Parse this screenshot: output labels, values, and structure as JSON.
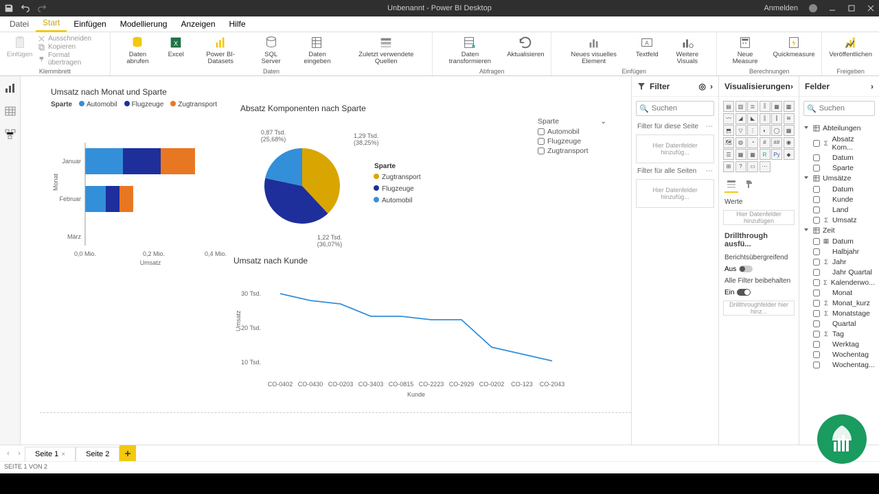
{
  "titlebar": {
    "title": "Unbenannt - Power BI Desktop",
    "signin": "Anmelden"
  },
  "menu": {
    "file": "Datei",
    "tabs": [
      "Start",
      "Einfügen",
      "Modellierung",
      "Anzeigen",
      "Hilfe"
    ],
    "active": 0
  },
  "ribbon": {
    "clip": {
      "paste": "Einfügen",
      "cut": "Ausschneiden",
      "copy": "Kopieren",
      "format": "Format übertragen",
      "label": "Klemmbrett"
    },
    "data": {
      "get": "Daten\nabrufen",
      "excel": "Excel",
      "pbids": "Power\nBI-Datasets",
      "sql": "SQL\nServer",
      "enter": "Daten\neingeben",
      "recent": "Zuletzt verwendete\nQuellen",
      "label": "Daten"
    },
    "query": {
      "transform": "Daten\ntransformieren",
      "refresh": "Aktualisieren",
      "label": "Abfragen"
    },
    "insert": {
      "visual": "Neues visuelles\nElement",
      "textbox": "Textfeld",
      "more": "Weitere\nVisuals",
      "label": "Einfügen"
    },
    "calc": {
      "measure": "Neue\nMeasure",
      "quick": "Quickmeasure",
      "label": "Berechnungen"
    },
    "share": {
      "publish": "Veröffentlichen",
      "label": "Freigeben"
    }
  },
  "filters": {
    "title": "Filter",
    "search": "Suchen",
    "page": "Filter für diese Seite",
    "page_hint": "Hier Datenfelder hinzufüg...",
    "all": "Filter für alle Seiten",
    "all_hint": "Hier Datenfelder hinzufüg..."
  },
  "vis": {
    "title": "Visualisierungen",
    "values": "Werte",
    "values_hint": "Hier Datenfelder hinzufügen",
    "drill": "Drillthrough ausfü...",
    "cross": "Berichtsübergreifend",
    "off": "Aus",
    "keep": "Alle Filter beibehalten",
    "on": "Ein",
    "drill_hint": "Drillthroughfelder hier hinz..."
  },
  "fields": {
    "title": "Felder",
    "search": "Suchen",
    "tables": [
      {
        "name": "Abteilungen",
        "fields": [
          {
            "name": "Absatz Kom...",
            "sig": "Σ"
          },
          {
            "name": "Datum"
          },
          {
            "name": "Sparte"
          }
        ]
      },
      {
        "name": "Umsätze",
        "fields": [
          {
            "name": "Datum"
          },
          {
            "name": "Kunde"
          },
          {
            "name": "Land"
          },
          {
            "name": "Umsatz",
            "sig": "Σ"
          }
        ]
      },
      {
        "name": "Zeit",
        "fields": [
          {
            "name": "Datum",
            "sig": "▦"
          },
          {
            "name": "Halbjahr"
          },
          {
            "name": "Jahr",
            "sig": "Σ"
          },
          {
            "name": "Jahr Quartal"
          },
          {
            "name": "Kalenderwo...",
            "sig": "Σ"
          },
          {
            "name": "Monat"
          },
          {
            "name": "Monat_kurz",
            "sig": "Σ"
          },
          {
            "name": "Monatstage",
            "sig": "Σ"
          },
          {
            "name": "Quartal"
          },
          {
            "name": "Tag",
            "sig": "Σ"
          },
          {
            "name": "Werktag"
          },
          {
            "name": "Wochentag"
          },
          {
            "name": "Wochentag..."
          }
        ]
      }
    ]
  },
  "slicer": {
    "title": "Sparte",
    "options": [
      "Automobil",
      "Flugzeuge",
      "Zugtransport"
    ]
  },
  "tabs": {
    "pages": [
      "Seite 1",
      "Seite 2"
    ],
    "status": "SEITE 1 VON 2"
  },
  "colors": {
    "auto": "#338fd9",
    "flug": "#1e2f9b",
    "zug": "#e87722",
    "zugpie": "#d9a500"
  },
  "chart_data": [
    {
      "type": "bar",
      "title": "Umsatz nach Monat und Sparte",
      "legend_label": "Sparte",
      "series_names": [
        "Automobil",
        "Flugzeuge",
        "Zugtransport"
      ],
      "categories": [
        "Januar",
        "Februar",
        "März"
      ],
      "series": [
        {
          "name": "Automobil",
          "values": [
            0.11,
            0.06,
            0
          ]
        },
        {
          "name": "Flugzeuge",
          "values": [
            0.11,
            0.04,
            0
          ]
        },
        {
          "name": "Zugtransport",
          "values": [
            0.1,
            0.04,
            0
          ]
        }
      ],
      "xlabel": "Umsatz",
      "xticks": [
        "0,0 Mio.",
        "0,2 Mio.",
        "0,4 Mio."
      ],
      "xlim": [
        0,
        0.4
      ],
      "orientation": "horizontal-stacked"
    },
    {
      "type": "pie",
      "title": "Absatz Komponenten nach Sparte",
      "legend_label": "Sparte",
      "slices": [
        {
          "name": "Zugtransport",
          "value": 1290,
          "pct": 38.25,
          "label": "1,29 Tsd.\n(38,25%)"
        },
        {
          "name": "Flugzeuge",
          "value": 1220,
          "pct": 36.07,
          "label": "1,22 Tsd.\n(36,07%)"
        },
        {
          "name": "Automobil",
          "value": 870,
          "pct": 25.68,
          "label": "0,87 Tsd.\n(25,68%)"
        }
      ]
    },
    {
      "type": "line",
      "title": "Umsatz nach Kunde",
      "x": [
        "CO-0402",
        "CO-0430",
        "CO-0203",
        "CO-3403",
        "CO-0815",
        "CO-2223",
        "CO-2929",
        "CO-0202",
        "CO-123",
        "CO-2043"
      ],
      "values": [
        30,
        28,
        27,
        24,
        24,
        23,
        23,
        15,
        13,
        11
      ],
      "ylabel": "Umsatz",
      "xlabel": "Kunde",
      "yticks": [
        "30 Tsd.",
        "20 Tsd.",
        "10 Tsd."
      ],
      "ylim": [
        0,
        35
      ]
    }
  ]
}
